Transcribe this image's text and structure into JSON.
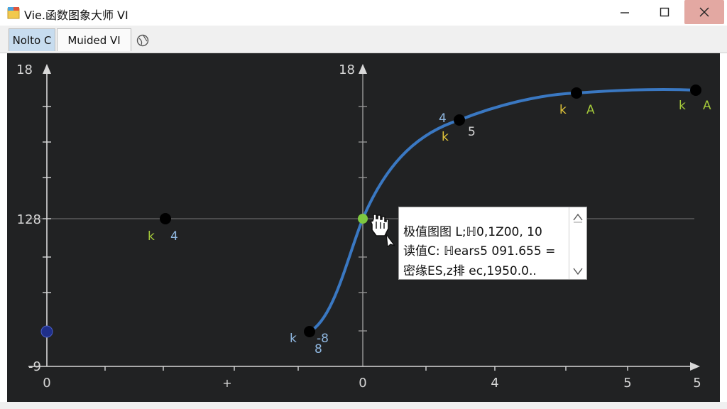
{
  "window": {
    "title": "Vie.函数图象大师 VI",
    "min_glyph": "—",
    "max_glyph": "☐",
    "close_glyph": "✕"
  },
  "tabs": [
    {
      "label": "Nolto C"
    },
    {
      "label": "Muided VI"
    }
  ],
  "plot": {
    "left_axis": {
      "top_label": "18",
      "mid_label": "128",
      "bottom_label": "-9"
    },
    "center_axis": {
      "top_label": "18"
    },
    "x_ticks": [
      "0",
      "+",
      "0",
      "4",
      "5",
      "5"
    ],
    "point_labels": [
      {
        "label": "4",
        "marker": "k"
      },
      {
        "label": "-8",
        "sub": "8",
        "marker": "k"
      },
      {
        "label": "5",
        "top": "4",
        "marker": "k"
      },
      {
        "label": "A",
        "marker": "k"
      },
      {
        "label": "A",
        "marker": "k"
      }
    ],
    "curve_color": "#3a78c2",
    "point_color": "#000000",
    "highlight_color": "#7ec840",
    "endpoint_color": "#1f2f8a"
  },
  "tooltip": {
    "line1": "极值图图 L;ℍ0,1Z00, 10",
    "line2": "读值C: ℍears5 091.655 =",
    "line3": "密缘ES,z排 ec,1950.0.."
  }
}
